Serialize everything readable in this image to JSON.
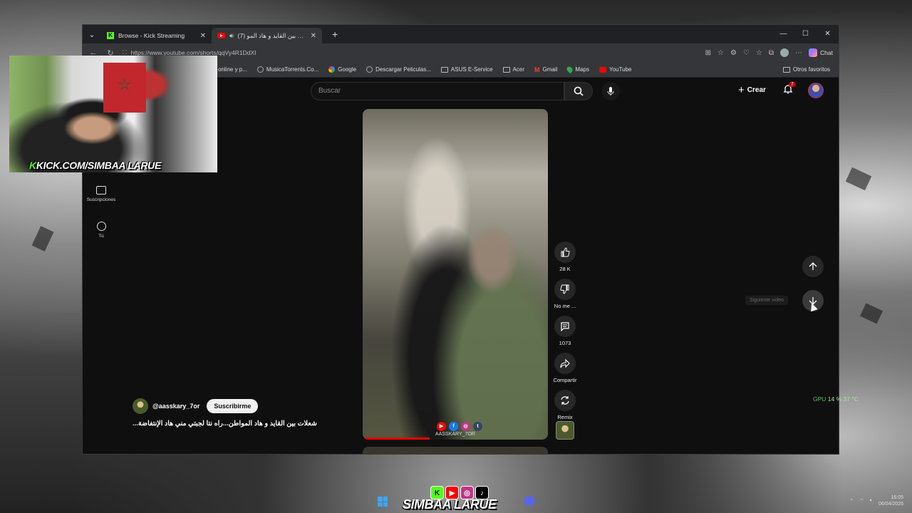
{
  "browser": {
    "tabs": [
      {
        "label": "Browse - Kick Streaming",
        "icon": "kick-icon",
        "active": false
      },
      {
        "label": "(7) شعلات بين القايد و هاد المو...",
        "icon": "youtube-icon",
        "active": true
      }
    ],
    "url": "https://www.youtube.com/shorts/qqVy4R1DdXI",
    "chat_label": "Chat",
    "bookmarks": [
      {
        "label": "online y p...",
        "icon": "globe-icon"
      },
      {
        "label": "MusicaTorrents.Co...",
        "icon": "globe-icon"
      },
      {
        "label": "Google",
        "icon": "google-icon"
      },
      {
        "label": "Descargar Peliculas...",
        "icon": "globe-icon"
      },
      {
        "label": "ASUS E-Service",
        "icon": "folder-icon"
      },
      {
        "label": "Acer",
        "icon": "folder-icon"
      },
      {
        "label": "Gmail",
        "icon": "gmail-icon"
      },
      {
        "label": "Maps",
        "icon": "maps-icon"
      },
      {
        "label": "YouTube",
        "icon": "youtube-icon"
      }
    ],
    "other_favorites": "Otros favoritos"
  },
  "youtube": {
    "search_placeholder": "Buscar",
    "create_label": "Crear",
    "notification_count": "7",
    "sidebar": [
      {
        "label": "Suscripciones",
        "icon": "subscriptions-icon"
      },
      {
        "label": "Tú",
        "icon": "you-icon"
      }
    ],
    "actions": {
      "likes": "28 K",
      "dislike": "No me ...",
      "comments": "1073",
      "share": "Compartir",
      "remix": "Remix"
    },
    "channel": {
      "handle": "@aasskary_7or",
      "subscribe": "Suscribirme"
    },
    "video_title": "شعلات بين القايد و هاد المواطن...راه نتا لجبتي مني هاد الإنتفاضة...",
    "watermark": "AASSKARY_7OR",
    "progress_fraction": 0.36,
    "next_tooltip": "Siguiente video"
  },
  "overlay": {
    "webcam_label_k": "K",
    "webcam_label": "KICK.COM/SIMBAA LARUE",
    "gpu_prefix": "GPU",
    "gpu_usage": "14 %",
    "gpu_temp": "37 °C",
    "brand": "SIMBAA LARUE"
  },
  "taskbar": {
    "time": "16:05",
    "date": "06/04/2026"
  },
  "colors": {
    "kick_green": "#53fc18",
    "youtube_red": "#ff0000",
    "gpu_green": "#4cc44c"
  }
}
